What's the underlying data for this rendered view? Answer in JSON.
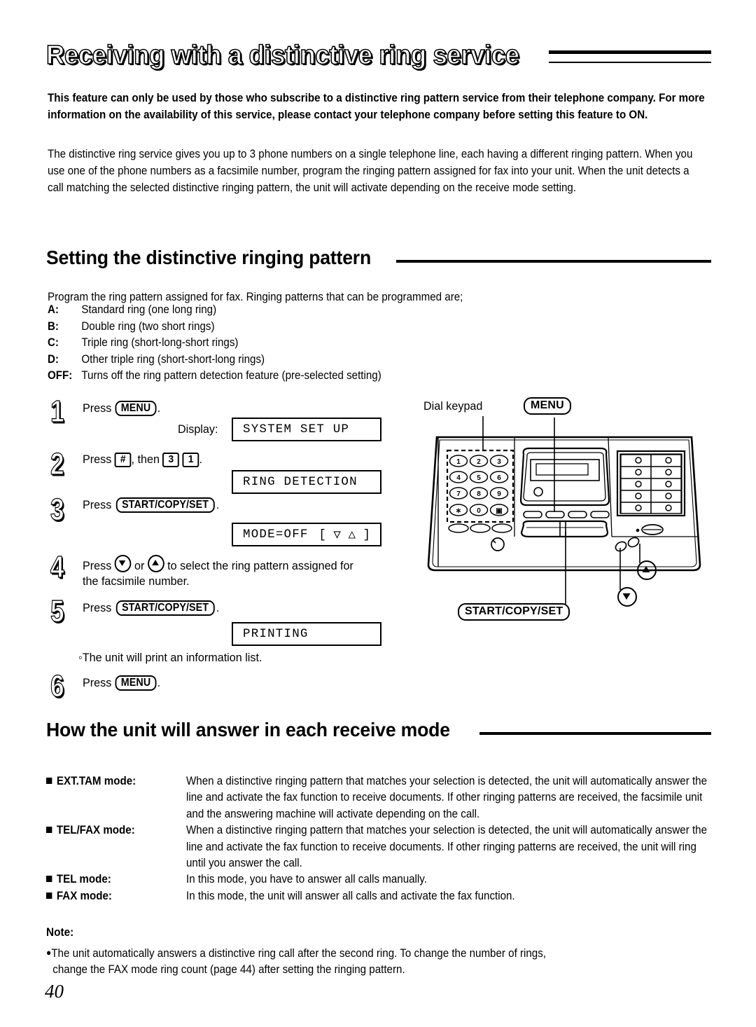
{
  "document": {
    "main_title": "Receiving with a distinctive ring service",
    "page_number": "40"
  },
  "intro": {
    "bold_paragraph": "This feature can only be used by those who subscribe to a distinctive ring pattern service from their telephone company. For more information on the availability of this service, please contact your telephone company before setting this feature to ON.",
    "body_paragraph": "The distinctive ring service gives you up to 3 phone numbers on a single telephone line, each having a different ringing pattern. When you use one of the phone numbers as a facsimile number, program the ringing pattern assigned for fax into your unit. When the unit detects a call matching the selected distinctive ringing pattern, the unit will activate depending on the receive mode setting."
  },
  "setting_section": {
    "heading": "Setting the distinctive ringing pattern",
    "intro": "Program the ring pattern assigned for fax. Ringing patterns that can be programmed are;",
    "patterns": [
      {
        "key": "A:",
        "value": "Standard ring (one long ring)"
      },
      {
        "key": "B:",
        "value": "Double ring (two short rings)"
      },
      {
        "key": "C:",
        "value": "Triple ring (short-long-short rings)"
      },
      {
        "key": "D:",
        "value": "Other triple ring (short-short-long rings)"
      },
      {
        "key": "OFF:",
        "value": "Turns off the ring pattern detection feature (pre-selected setting)"
      }
    ],
    "steps": {
      "s1_num": "1",
      "s1_press": "Press",
      "s1_key": "MENU",
      "s1_period": ".",
      "display_label": "Display:",
      "lcd1": "SYSTEM SET UP",
      "s2_num": "2",
      "s2_press": "Press",
      "s2_key_hash": "#",
      "s2_then": ", then",
      "s2_key_3": "3",
      "s2_key_1": "1",
      "s2_period": ".",
      "lcd2": "RING DETECTION",
      "s3_num": "3",
      "s3_press": "Press",
      "s3_key": "START/COPY/SET",
      "s3_period": ".",
      "lcd3_left": "MODE=OFF",
      "lcd3_right": "[ ▽ △ ]",
      "s4_num": "4",
      "s4_press": "Press",
      "s4_or": "or",
      "s4_tail": "to select the ring pattern assigned for the facsimile number.",
      "s5_num": "5",
      "s5_press": "Press",
      "s5_key": "START/COPY/SET",
      "s5_period": ".",
      "lcd4": "PRINTING",
      "s5_note": "The unit will print an information list.",
      "s6_num": "6",
      "s6_press": "Press",
      "s6_key": "MENU",
      "s6_period": "."
    }
  },
  "diagram": {
    "keypad_label": "Dial keypad",
    "menu_label": "MENU",
    "start_label": "START/COPY/SET",
    "keypad_keys": [
      "1",
      "2",
      "3",
      "4",
      "5",
      "6",
      "7",
      "8",
      "9",
      "∗",
      "0",
      "□"
    ],
    "down_arrow_icon": "down-triangle-icon",
    "up_arrow_icon": "up-triangle-icon"
  },
  "receive_modes": {
    "heading": "How the unit will answer in each receive mode",
    "rows": [
      {
        "label": "EXT.TAM mode:",
        "desc": "When a distinctive ringing pattern that matches your selection is detected, the unit will automatically answer the line and activate the fax function to receive documents. If other ringing patterns are received, the facsimile unit and the answering machine will activate depending on the call."
      },
      {
        "label": "TEL/FAX mode:",
        "desc": "When a distinctive ringing pattern that matches your selection is detected, the unit will automatically answer the line and activate the fax function to receive documents. If other ringing patterns are received, the unit will ring until you answer the call."
      },
      {
        "label": "TEL mode:",
        "desc": "In this mode, you have to answer all calls manually."
      },
      {
        "label": "FAX mode:",
        "desc": "In this mode, the unit will answer all calls and activate the fax function."
      }
    ]
  },
  "note": {
    "heading": "Note:",
    "line1": "The unit automatically answers a distinctive ring call after the second ring. To change the number of rings,",
    "line2": "change the FAX mode ring count (page 44) after setting the ringing pattern."
  }
}
